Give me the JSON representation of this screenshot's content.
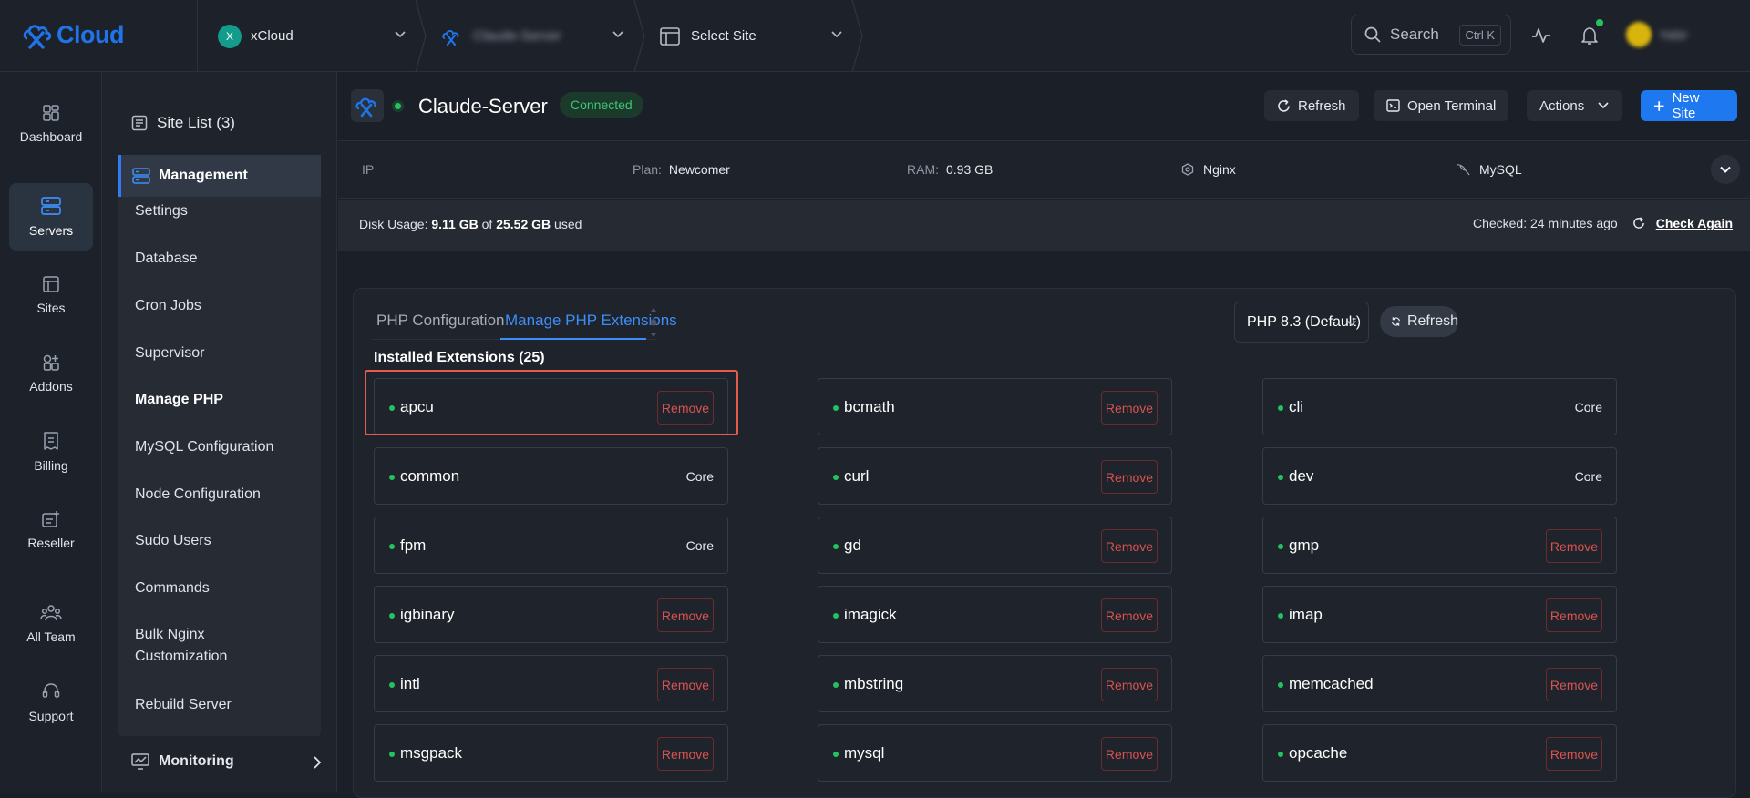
{
  "topbar": {
    "logo_text": "Cloud",
    "team_avatar_letter": "X",
    "team_name": "xCloud",
    "server_crumb": "Claude-Server",
    "site_crumb": "Select Site",
    "search_label": "Search",
    "search_shortcut": "Ctrl K",
    "user_name": "Yabir"
  },
  "rail": {
    "items": [
      {
        "label": "Dashboard",
        "icon": "dashboard-icon"
      },
      {
        "label": "Servers",
        "icon": "servers-icon",
        "active": true
      },
      {
        "label": "Sites",
        "icon": "sites-icon"
      },
      {
        "label": "Addons",
        "icon": "addons-icon"
      },
      {
        "label": "Billing",
        "icon": "billing-icon"
      },
      {
        "label": "Reseller",
        "icon": "reseller-icon"
      },
      {
        "label": "All Team",
        "icon": "team-icon"
      },
      {
        "label": "Support",
        "icon": "support-icon"
      }
    ]
  },
  "submenu": {
    "site_list": "Site List (3)",
    "management": "Management",
    "items": [
      "Settings",
      "Database",
      "Cron Jobs",
      "Supervisor",
      "Manage PHP",
      "MySQL Configuration",
      "Node Configuration",
      "Sudo Users",
      "Commands",
      "Bulk Nginx Customization",
      "Rebuild Server"
    ],
    "active_item": "Manage PHP",
    "monitoring": "Monitoring"
  },
  "server": {
    "name": "Claude-Server",
    "status": "Connected",
    "buttons": {
      "refresh": "Refresh",
      "terminal": "Open Terminal",
      "actions": "Actions",
      "new_site": "New Site"
    },
    "info": {
      "ip_key": "IP",
      "plan_key": "Plan:",
      "plan_val": "Newcomer",
      "ram_key": "RAM:",
      "ram_val": "0.93 GB",
      "web_server": "Nginx",
      "db_server": "MySQL"
    },
    "disk": {
      "prefix": "Disk Usage:",
      "used": "9.11 GB",
      "of": "of",
      "total": "25.52 GB",
      "suffix": "used"
    },
    "checked": "Checked: 24 minutes ago",
    "check_again": "Check Again"
  },
  "php": {
    "tabs": [
      "PHP Configuration",
      "Manage PHP Extensions"
    ],
    "active_tab": "Manage PHP Extensions",
    "version": "PHP 8.3 (Default)",
    "refresh": "Refresh",
    "installed_title": "Installed Extensions (25)",
    "remove_label": "Remove",
    "core_label": "Core",
    "extensions": [
      {
        "name": "apcu",
        "type": "remove"
      },
      {
        "name": "bcmath",
        "type": "remove"
      },
      {
        "name": "cli",
        "type": "core"
      },
      {
        "name": "common",
        "type": "core"
      },
      {
        "name": "curl",
        "type": "remove"
      },
      {
        "name": "dev",
        "type": "core"
      },
      {
        "name": "fpm",
        "type": "core"
      },
      {
        "name": "gd",
        "type": "remove"
      },
      {
        "name": "gmp",
        "type": "remove"
      },
      {
        "name": "igbinary",
        "type": "remove"
      },
      {
        "name": "imagick",
        "type": "remove"
      },
      {
        "name": "imap",
        "type": "remove"
      },
      {
        "name": "intl",
        "type": "remove"
      },
      {
        "name": "mbstring",
        "type": "remove"
      },
      {
        "name": "memcached",
        "type": "remove"
      },
      {
        "name": "msgpack",
        "type": "remove"
      },
      {
        "name": "mysql",
        "type": "remove"
      },
      {
        "name": "opcache",
        "type": "remove"
      }
    ]
  },
  "colors": {
    "accent": "#1e78f0",
    "online": "#22c35e",
    "danger": "#d9534f",
    "highlight": "#e55c4d"
  }
}
